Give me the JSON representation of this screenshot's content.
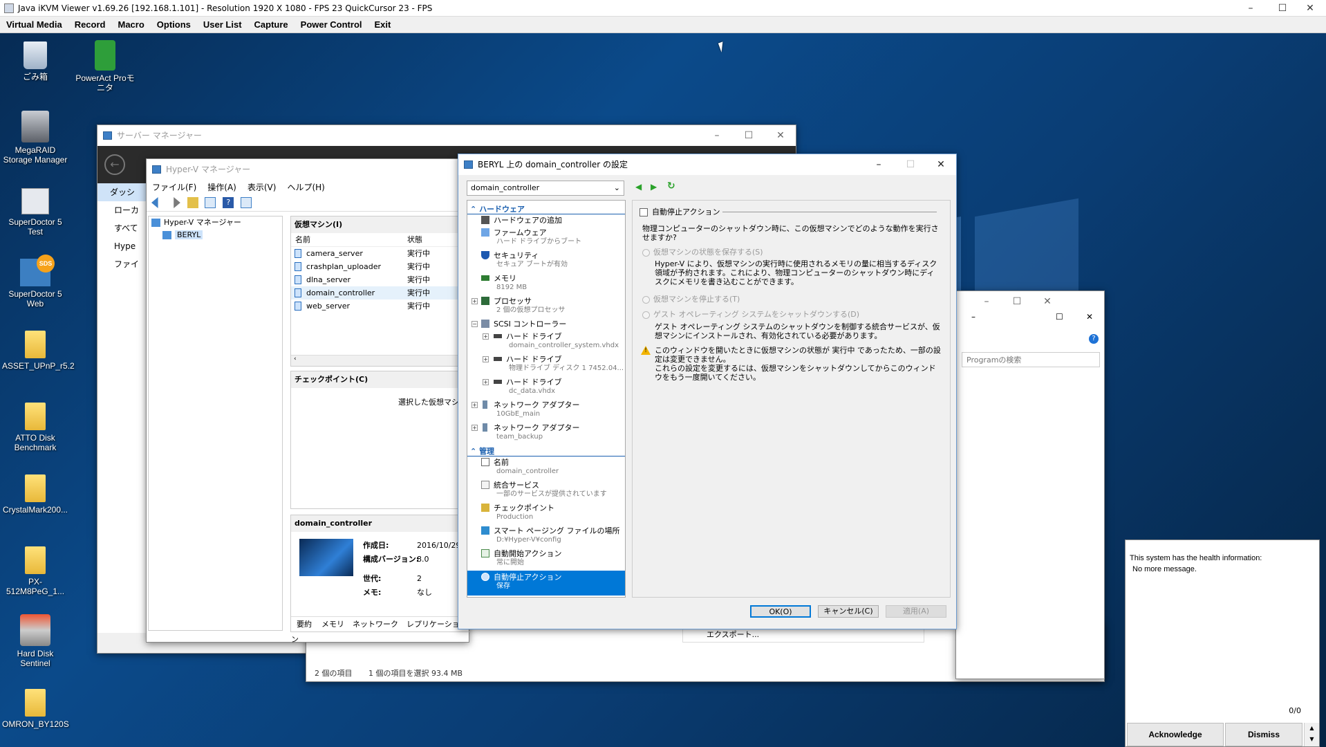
{
  "kvm": {
    "title": "Java iKVM Viewer v1.69.26 [192.168.1.101]  - Resolution 1920 X 1080 - FPS 23 QuickCursor 23 - FPS",
    "menu": [
      "Virtual Media",
      "Record",
      "Macro",
      "Options",
      "User List",
      "Capture",
      "Power Control",
      "Exit"
    ]
  },
  "desktop": {
    "icons": [
      {
        "label": "ごみ箱",
        "icon": "recycle-bin-icon"
      },
      {
        "label": "PowerAct Proモニタ",
        "icon": "power-plug-icon"
      },
      {
        "label": "MegaRAID Storage Manager",
        "icon": "server-icon"
      },
      {
        "label": "SuperDoctor 5 Test",
        "icon": "gear-icon"
      },
      {
        "label": "SuperDoctor 5 Web",
        "icon": "sds-icon",
        "badge": "SDS"
      },
      {
        "label": "ASSET_UPnP_r5.2",
        "icon": "folder-icon"
      },
      {
        "label": "ATTO Disk Benchmark",
        "icon": "folder-icon"
      },
      {
        "label": "CrystalMark200...",
        "icon": "folder-icon"
      },
      {
        "label": "PX-512M8PeG_1...",
        "icon": "folder-icon"
      },
      {
        "label": "Hard Disk Sentinel",
        "icon": "disk-icon"
      },
      {
        "label": "OMRON_BY120S",
        "icon": "folder-icon"
      }
    ]
  },
  "server_manager": {
    "title": "サーバー マネージャー",
    "nav": [
      "ダッシ",
      "ローカ",
      "すべて",
      "Hype",
      "ファイ"
    ]
  },
  "hyperv": {
    "title": "Hyper-V マネージャー",
    "menu": [
      "ファイル(F)",
      "操作(A)",
      "表示(V)",
      "ヘルプ(H)"
    ],
    "tree_root": "Hyper-V マネージャー",
    "tree_host": "BERYL",
    "vm_header": "仮想マシン(I)",
    "col_name": "名前",
    "col_state": "状態",
    "vms": [
      {
        "name": "camera_server",
        "state": "実行中"
      },
      {
        "name": "crashplan_uploader",
        "state": "実行中"
      },
      {
        "name": "dlna_server",
        "state": "実行中"
      },
      {
        "name": "domain_controller",
        "state": "実行中"
      },
      {
        "name": "web_server",
        "state": "実行中"
      }
    ],
    "checkpoint_header": "チェックポイント(C)",
    "checkpoint_msg": "選択した仮想マシ",
    "detail_header": "domain_controller",
    "details": [
      {
        "k": "作成日:",
        "v": "2016/10/29"
      },
      {
        "k": "構成バージョン:",
        "v": "8.0"
      },
      {
        "k": "世代:",
        "v": "2"
      },
      {
        "k": "メモ:",
        "v": "なし"
      }
    ],
    "tabs": [
      "要約",
      "メモリ",
      "ネットワーク",
      "レプリケーション"
    ]
  },
  "explorer": {
    "status_items": "2 個の項目",
    "status_selected": "1 個の項目を選択  93.4 MB",
    "export_label": "エクスポート...",
    "search_placeholder": "Programの検索"
  },
  "settings": {
    "title": "BERYL 上の domain_controller の設定",
    "vm_select": "domain_controller",
    "hardware_head": "ハードウェア",
    "management_head": "管理",
    "hardware": [
      {
        "t1": "ハードウェアの追加",
        "t2": ""
      },
      {
        "t1": "ファームウェア",
        "t2": "ハード ドライブからブート"
      },
      {
        "t1": "セキュリティ",
        "t2": "セキュア ブートが有効"
      },
      {
        "t1": "メモリ",
        "t2": "8192 MB"
      },
      {
        "t1": "プロセッサ",
        "t2": "2 個の仮想プロセッサ"
      },
      {
        "t1": "SCSI コントローラー",
        "t2": ""
      },
      {
        "t1": "ハード ドライブ",
        "t2": "domain_controller_system.vhdx"
      },
      {
        "t1": "ハード ドライブ",
        "t2": "物理ドライブ ディスク 1 7452.04..."
      },
      {
        "t1": "ハード ドライブ",
        "t2": "dc_data.vhdx"
      },
      {
        "t1": "ネットワーク アダプター",
        "t2": "10GbE_main"
      },
      {
        "t1": "ネットワーク アダプター",
        "t2": "team_backup"
      }
    ],
    "management": [
      {
        "t1": "名前",
        "t2": "domain_controller"
      },
      {
        "t1": "統合サービス",
        "t2": "一部のサービスが提供されています"
      },
      {
        "t1": "チェックポイント",
        "t2": "Production"
      },
      {
        "t1": "スマート ページング ファイルの場所",
        "t2": "D:¥Hyper-V¥config"
      },
      {
        "t1": "自動開始アクション",
        "t2": "常に開始"
      },
      {
        "t1": "自動停止アクション",
        "t2": "保存"
      }
    ],
    "panel_title": "自動停止アクション",
    "question": "物理コンピューターのシャットダウン時に、この仮想マシンでどのような動作を実行させますか?",
    "opt_save": "仮想マシンの状態を保存する(S)",
    "opt_save_desc": "Hyper-V により、仮想マシンの実行時に使用されるメモリの量に相当するディスク領域が予約されます。これにより、物理コンピューターのシャットダウン時にディスクにメモリを書き込むことができます。",
    "opt_off": "仮想マシンを停止する(T)",
    "opt_shutdown": "ゲスト オペレーティング システムをシャットダウンする(D)",
    "opt_shutdown_desc": "ゲスト オペレーティング システムのシャットダウンを制御する統合サービスが、仮想マシンにインストールされ、有効化されている必要があります。",
    "warning": "このウィンドウを開いたときに仮想マシンの状態が 実行中 であったため、一部の設定は変更できません。\nこれらの設定を変更するには、仮想マシンをシャットダウンしてからこのウィンドウをもう一度開いてください。",
    "ok": "OK(O)",
    "cancel": "キャンセル(C)",
    "apply": "適用(A)"
  },
  "health": {
    "message": "This system has the health information:",
    "submessage": "No more message.",
    "counter": "0/0",
    "acknowledge": "Acknowledge",
    "dismiss": "Dismiss"
  }
}
